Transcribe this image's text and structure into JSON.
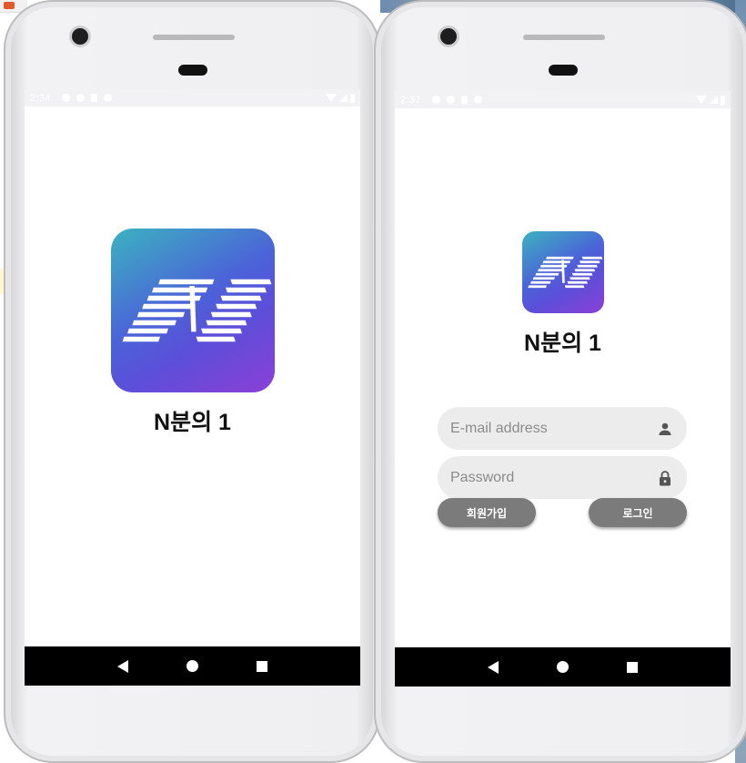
{
  "phones": {
    "left": {
      "status": {
        "time": "2:34"
      },
      "screen_name": "splash",
      "app_title": "N분의 1"
    },
    "right": {
      "status": {
        "time": "2:37"
      },
      "screen_name": "login",
      "app_title": "N분의 1",
      "email_field": {
        "placeholder": "E-mail address",
        "value": "",
        "icon": "person-icon"
      },
      "password_field": {
        "placeholder": "Password",
        "value": "",
        "icon": "lock-icon"
      },
      "signup_button": "회원가입",
      "login_button": "로그인"
    }
  },
  "navbar": {
    "icons": [
      "back-icon",
      "home-icon",
      "recent-apps-icon"
    ]
  },
  "colors": {
    "logo_gradient": [
      "#3cb3c0",
      "#4b63d8",
      "#8c3fd6"
    ],
    "button": "#7b7b7b",
    "field": "#ececec",
    "navbar": "#000000"
  }
}
